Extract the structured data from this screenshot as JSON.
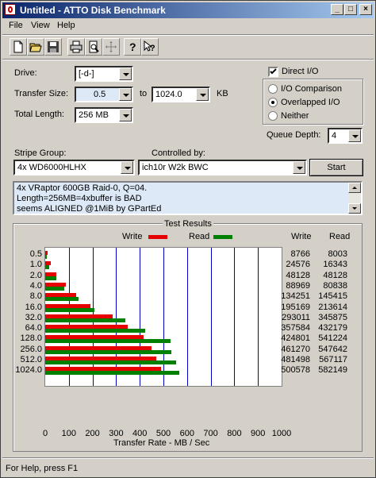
{
  "window": {
    "title": "Untitled - ATTO Disk Benchmark"
  },
  "titlebar_buttons": {
    "min": "_",
    "max": "□",
    "close": "×"
  },
  "menu": [
    "File",
    "View",
    "Help"
  ],
  "toolbar": [
    "new-icon",
    "open-icon",
    "save-icon",
    "print-icon",
    "print-preview-icon",
    "move-icon",
    "help-icon",
    "context-help-icon"
  ],
  "form": {
    "drive_label": "Drive:",
    "drive_value": "[-d-]",
    "transfer_size_label": "Transfer Size:",
    "transfer_from": "0.5",
    "to_label": "to",
    "transfer_to": "1024.0",
    "kb_label": "KB",
    "total_length_label": "Total Length:",
    "total_length_value": "256 MB",
    "direct_io_label": "Direct I/O",
    "direct_io_checked": true,
    "io_comparison_label": "I/O Comparison",
    "overlapped_io_label": "Overlapped I/O",
    "neither_label": "Neither",
    "selected_io_mode": "Overlapped I/O",
    "queue_depth_label": "Queue Depth:",
    "queue_depth_value": "4",
    "stripe_group_label": "Stripe Group:",
    "stripe_group_value": "4x WD6000HLHX",
    "controlled_by_label": "Controlled by:",
    "controlled_by_value": "ich10r W2k BWC",
    "start_button": "Start"
  },
  "notes": [
    "4x VRaptor 600GB Raid-0, Q=04.",
    "Length=256MB=4xbuffer is BAD",
    "seems ALIGNED @1MiB by GPartEd"
  ],
  "results": {
    "title": "Test Results",
    "legend_write": "Write",
    "legend_read": "Read",
    "col_write": "Write",
    "col_read": "Read",
    "write_color": "#e60000",
    "read_color": "#008000"
  },
  "chart_data": {
    "type": "bar",
    "title": "Test Results",
    "xlabel": "Transfer Rate - MB / Sec",
    "ylabel": "",
    "xlim": [
      0,
      1000
    ],
    "xticks": [
      "0",
      "100",
      "200",
      "300",
      "400",
      "500",
      "600",
      "700",
      "800",
      "900",
      "1000"
    ],
    "categories": [
      "0.5",
      "1.0",
      "2.0",
      "4.0",
      "8.0",
      "16.0",
      "32.0",
      "64.0",
      "128.0",
      "256.0",
      "512.0",
      "1024.0"
    ],
    "series": [
      {
        "name": "Write",
        "values_kb": [
          "8766",
          "24576",
          "48128",
          "88969",
          "134251",
          "195169",
          "293011",
          "357584",
          "424801",
          "461270",
          "481498",
          "500578"
        ]
      },
      {
        "name": "Read",
        "values_kb": [
          "8003",
          "16343",
          "48128",
          "80838",
          "145415",
          "213614",
          "345875",
          "432179",
          "541224",
          "547642",
          "567117",
          "582149"
        ]
      }
    ],
    "grid": true
  },
  "status": "For Help, press F1"
}
